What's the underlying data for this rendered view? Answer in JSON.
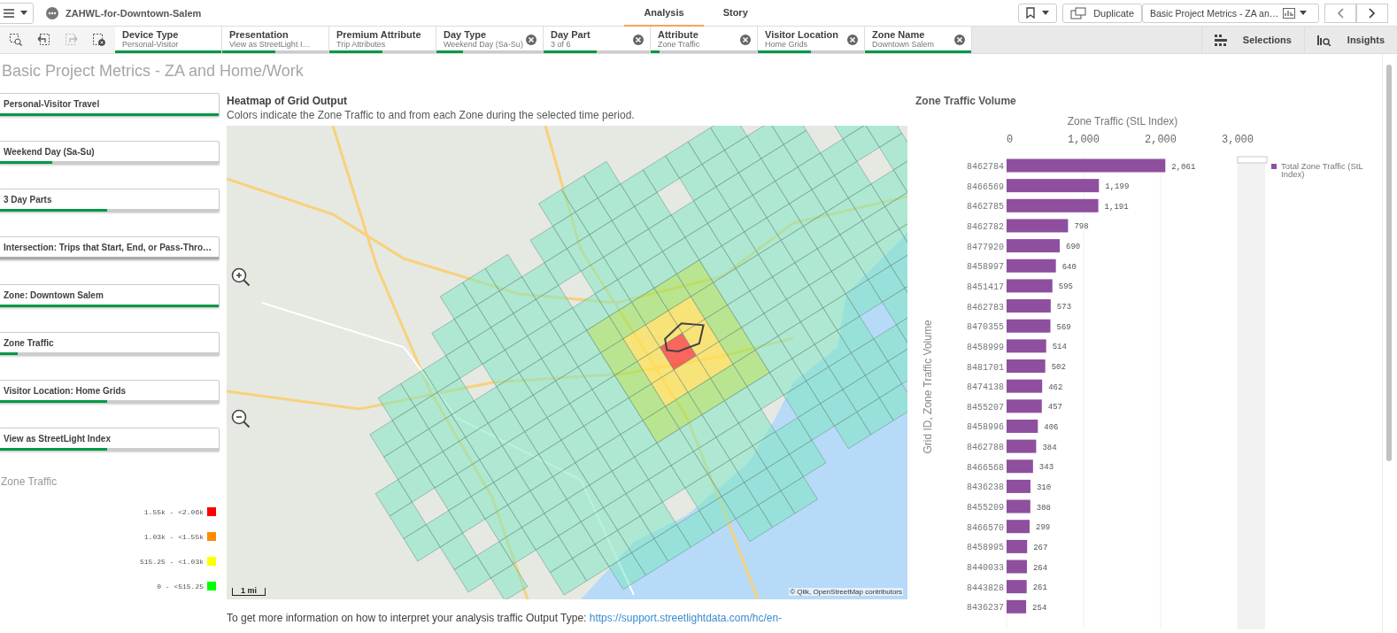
{
  "top_bar": {
    "app_title": "ZAHWL-for-Downtown-Salem",
    "tabs": [
      {
        "label": "Analysis",
        "selected": true
      },
      {
        "label": "Story",
        "selected": false
      }
    ],
    "duplicate_button": "Duplicate",
    "sheet_selector": "Basic Project Metrics - ZA an…"
  },
  "selection_bar": {
    "filters": [
      {
        "title": "Device Type",
        "value": "Personal-Visitor",
        "level": 1.0,
        "closable": false
      },
      {
        "title": "Presentation",
        "value": "View as StreetLight I…",
        "level": 0.5,
        "closable": false
      },
      {
        "title": "Premium Attribute",
        "value": "Trip Attributes",
        "level": 0.5,
        "closable": false
      },
      {
        "title": "Day Type",
        "value": "Weekend Day (Sa-Su)",
        "level": 0.25,
        "closable": true
      },
      {
        "title": "Day Part",
        "value": "3 of 6",
        "level": 0.5,
        "closable": true
      },
      {
        "title": "Attribute",
        "value": "Zone Traffic",
        "level": 0.08,
        "closable": true
      },
      {
        "title": "Visitor Location",
        "value": "Home Grids",
        "level": 0.5,
        "closable": true
      },
      {
        "title": "Zone Name",
        "value": "Downtown Salem",
        "level": 1.0,
        "closable": true
      }
    ],
    "buttons": [
      "Selections",
      "Insights"
    ]
  },
  "sheet_title": "Basic Project Metrics - ZA and Home/Work",
  "sidebar": {
    "buttons": [
      {
        "label": "Personal-Visitor Travel",
        "level": 1.0
      },
      {
        "label": "Weekend Day (Sa-Su)",
        "level": 0.24
      },
      {
        "label": "3 Day Parts",
        "level": 0.49
      },
      {
        "label": "Intersection: Trips that Start, End, or Pass-Thro…",
        "level": 0.0
      },
      {
        "label": "Zone: Downtown Salem",
        "level": 1.0
      },
      {
        "label": "Zone Traffic",
        "level": 0.08
      },
      {
        "label": "Visitor Location: Home Grids",
        "level": 0.49
      },
      {
        "label": "View as StreetLight Index",
        "level": 0.49
      }
    ],
    "legend": {
      "title": "Zone Traffic",
      "items": [
        {
          "label": "1.55k - <2.06k",
          "color": "#ff0000"
        },
        {
          "label": "1.03k - <1.55k",
          "color": "#ff8c00"
        },
        {
          "label": "515.25 - <1.03k",
          "color": "#ffff00"
        },
        {
          "label": "0 - <515.25",
          "color": "#00ff00"
        }
      ]
    }
  },
  "heatmap": {
    "title": "Heatmap of Grid Output",
    "subtitle": "Colors indicate the Zone Traffic to and from each Zone during the selected time period.",
    "scale": "1 mi",
    "attribution": "© Qlik, OpenStreetMap contributors"
  },
  "info": {
    "text": "To get more information on how to interpret your analysis traffic Output Type: ",
    "link": "https://support.streetlightdata.com/hc/en-"
  },
  "bar_chart": {
    "chart_data": {
      "type": "bar",
      "orientation": "horizontal",
      "title": "Zone Traffic Volume",
      "xlabel": "Zone Traffic (StL Index)",
      "ylabel": "Grid ID, Zone Traffic Volume",
      "categories": [
        "8462784",
        "8466569",
        "8462785",
        "8462782",
        "8477920",
        "8458997",
        "8451417",
        "8462783",
        "8470355",
        "8458999",
        "8481701",
        "8474138",
        "8455207",
        "8458996",
        "8462788",
        "8466568",
        "8436238",
        "8455209",
        "8466570",
        "8458995",
        "8440033",
        "8443828",
        "8436237"
      ],
      "series": [
        {
          "name": "Total Zone Traffic (StL Index)",
          "color": "#8e4f9f",
          "values": [
            2061,
            1199,
            1191,
            798,
            690,
            640,
            595,
            573,
            569,
            514,
            502,
            462,
            457,
            406,
            384,
            343,
            310,
            308,
            299,
            267,
            264,
            261,
            254
          ]
        }
      ],
      "xlim": [
        0,
        3000
      ],
      "xticks": [
        {
          "value": 0,
          "label": "0"
        },
        {
          "value": 1000,
          "label": "1,000"
        },
        {
          "value": 2000,
          "label": "2,000"
        },
        {
          "value": 3000,
          "label": "3,000"
        }
      ],
      "value_labels": [
        "2,061",
        "1,199",
        "1,191",
        "798",
        "690",
        "640",
        "595",
        "573",
        "569",
        "514",
        "502",
        "462",
        "457",
        "406",
        "384",
        "343",
        "310",
        "308",
        "299",
        "267",
        "264",
        "261",
        "254"
      ]
    }
  }
}
